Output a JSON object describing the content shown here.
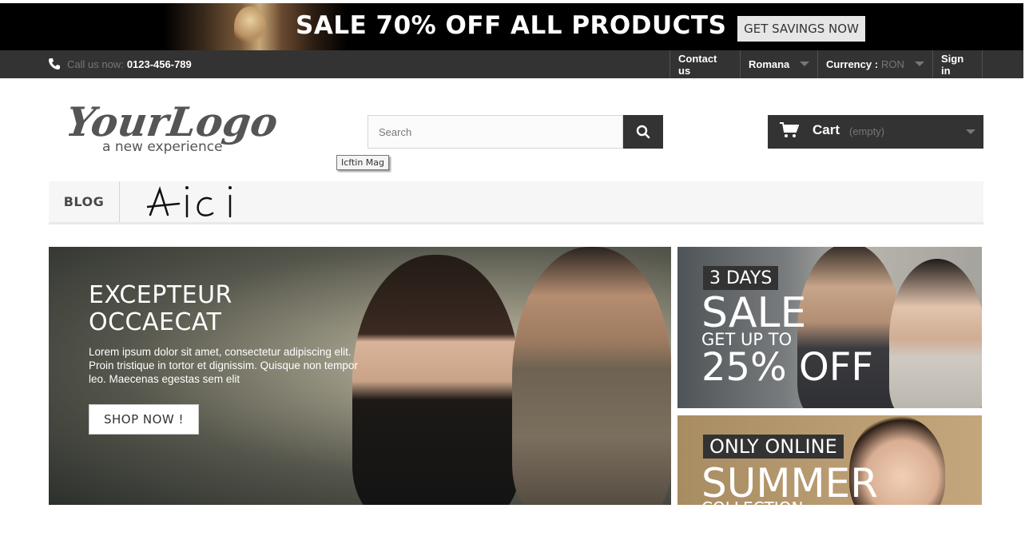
{
  "promo": {
    "title": "SALE 70% OFF ALL PRODUCTS",
    "button": "GET SAVINGS NOW"
  },
  "nav": {
    "phone_label": "Call us now:",
    "phone_number": "0123-456-789",
    "contact": "Contact us",
    "language": "Romana",
    "currency_label": "Currency :",
    "currency_value": "RON",
    "signin": "Sign in"
  },
  "header": {
    "logo_name": "YourLogo",
    "logo_tagline": "a new experience",
    "search_placeholder": "Search",
    "tooltip": "Icftin Mag",
    "cart_label": "Cart",
    "cart_status": "(empty)"
  },
  "menu": {
    "items": [
      "BLOG"
    ],
    "annotation": "Aici"
  },
  "hero": {
    "title_line1": "EXCEPTEUR",
    "title_line2": "OCCAECAT",
    "text": "Lorem ipsum dolor sit amet, consectetur adipiscing elit. Proin tristique in tortor et dignissim. Quisque non tempor leo. Maecenas egestas sem elit",
    "button": "SHOP NOW !"
  },
  "side_banner_1": {
    "tag": "3 DAYS",
    "line1": "SALE",
    "line2": "GET UP TO",
    "line3": "25% OFF"
  },
  "side_banner_2": {
    "tag": "ONLY ONLINE",
    "line1": "SUMMER",
    "line2": "COLLECTION"
  },
  "colors": {
    "nav_bg": "#333333",
    "promo_bg": "#000000",
    "menu_bg": "#f6f6f6"
  },
  "icons": [
    "phone-icon",
    "search-icon",
    "cart-icon",
    "chevron-down-icon"
  ]
}
